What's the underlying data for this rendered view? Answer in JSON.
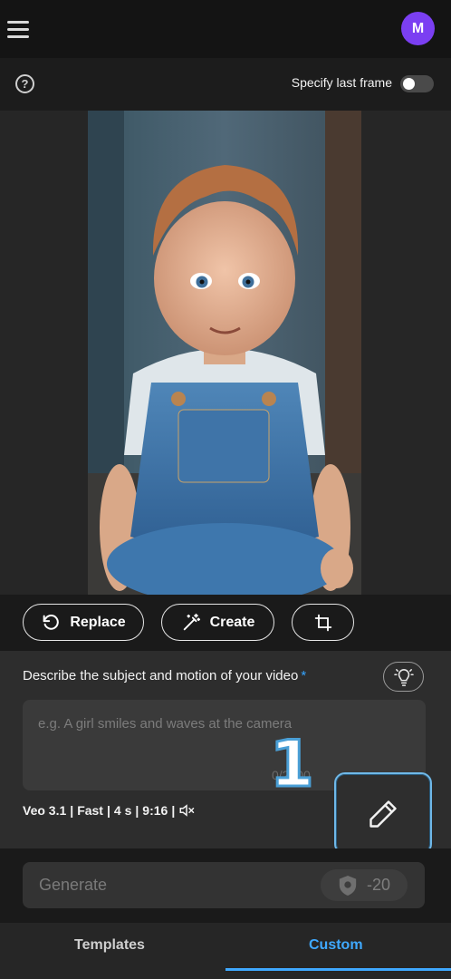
{
  "header": {
    "avatar_initial": "M"
  },
  "subheader": {
    "help_symbol": "?",
    "last_frame_label": "Specify last frame",
    "last_frame_enabled": false
  },
  "actions": {
    "replace_label": "Replace",
    "create_label": "Create"
  },
  "prompt": {
    "label": "Describe the subject and motion of your video",
    "required_mark": "*",
    "placeholder": "e.g. A girl smiles and waves at the camera",
    "counter": "0/2000"
  },
  "settings": {
    "model": "Veo 3.1",
    "speed": "Fast",
    "duration": "4 s",
    "aspect": "9:16",
    "sep": "|"
  },
  "overlay": {
    "step_number": "1"
  },
  "generate": {
    "label": "Generate",
    "cost": "-20"
  },
  "tabs": [
    {
      "label": "Templates",
      "active": false
    },
    {
      "label": "Custom",
      "active": true
    }
  ],
  "colors": {
    "accent": "#3fa9ff",
    "avatar": "#7b3ff2",
    "highlight": "#6fb8e8"
  }
}
